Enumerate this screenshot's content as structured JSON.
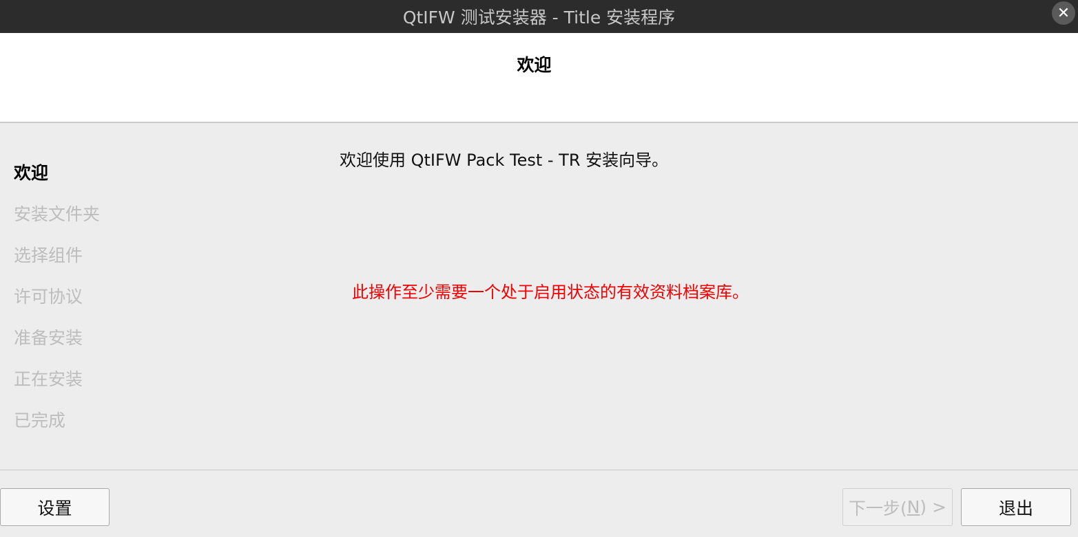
{
  "window": {
    "title": "QtIFW 测试安装器 - Title 安装程序",
    "close_glyph": "✕"
  },
  "header": {
    "title": "欢迎"
  },
  "sidebar": {
    "steps": [
      {
        "label": "欢迎",
        "active": true
      },
      {
        "label": "安装文件夹",
        "active": false
      },
      {
        "label": "选择组件",
        "active": false
      },
      {
        "label": "许可协议",
        "active": false
      },
      {
        "label": "准备安装",
        "active": false
      },
      {
        "label": "正在安装",
        "active": false
      },
      {
        "label": "已完成",
        "active": false
      }
    ]
  },
  "main": {
    "welcome_text": "欢迎使用 QtIFW Pack Test - TR 安装向导。",
    "error_text": "此操作至少需要一个处于启用状态的有效资料档案库。"
  },
  "buttons": {
    "settings": "设置",
    "next_prefix": "下一步(",
    "next_mnemonic": "N",
    "next_suffix": ") >",
    "quit": "退出"
  },
  "colors": {
    "titlebar_bg": "#2c2c2c",
    "error": "#f00000",
    "disabled_text": "#bdbdbd"
  },
  "icons": {
    "close": "close-icon"
  }
}
